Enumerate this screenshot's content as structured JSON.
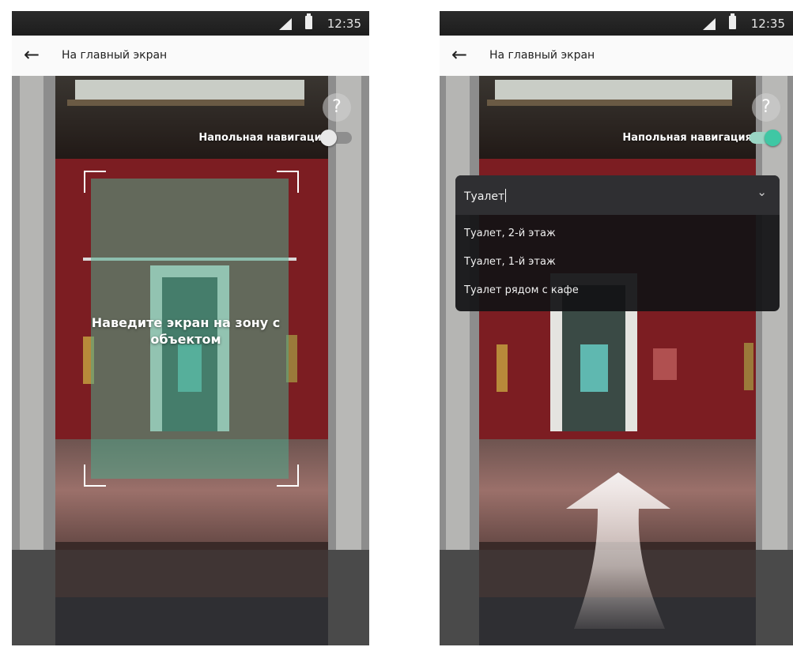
{
  "status_bar": {
    "time": "12:35"
  },
  "app_bar": {
    "back_icon": "←",
    "title": "На главный экран"
  },
  "overlay": {
    "help_label": "?",
    "floor_navigation_label": "Напольная навигация",
    "scan_hint": "Наведите экран на зону с объектом"
  },
  "left_screen": {
    "floor_navigation_enabled": false
  },
  "right_screen": {
    "floor_navigation_enabled": true,
    "search": {
      "value": "Туалет",
      "chevron_icon": "⌄",
      "options": [
        "Туалет, 2-й этаж",
        "Туалет, 1-й этаж",
        "Туалет рядом с кафе"
      ]
    }
  },
  "colors": {
    "accent_green": "#3fc7a4",
    "scan_frame_fill": "#4fa88a",
    "wall_red": "#7c1d22"
  }
}
